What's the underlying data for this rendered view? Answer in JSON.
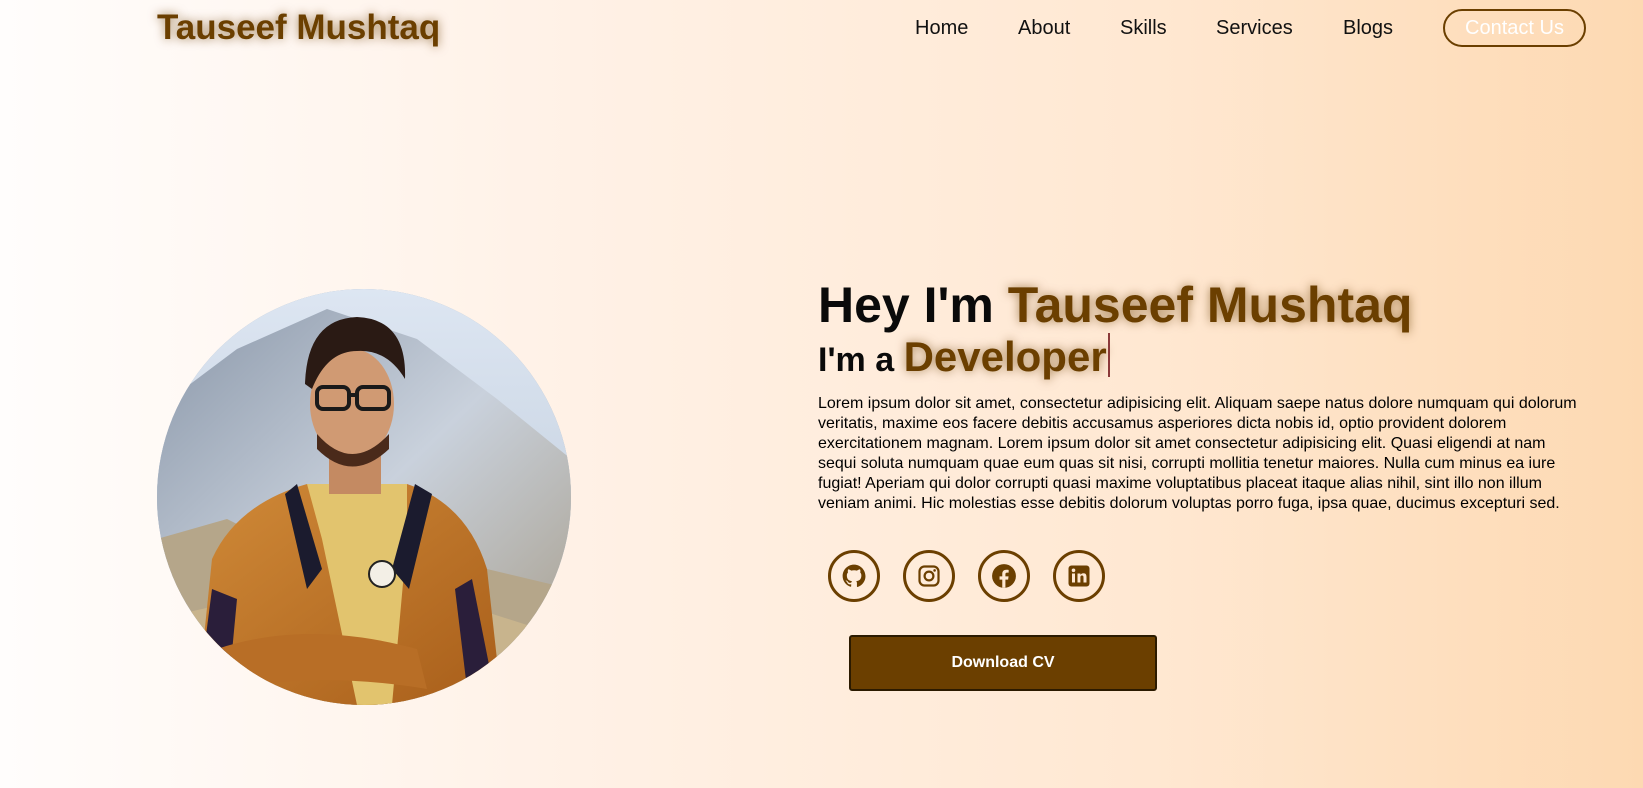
{
  "header": {
    "logo": "Tauseef Mushtaq",
    "nav": [
      {
        "label": "Home"
      },
      {
        "label": "About"
      },
      {
        "label": "Skills"
      },
      {
        "label": "Services"
      },
      {
        "label": "Blogs"
      }
    ],
    "contact_label": "Contact Us"
  },
  "hero": {
    "greeting": "Hey I'm ",
    "name": "Tauseef Mushtaq",
    "role_prefix": "I'm a ",
    "role": "Developer",
    "bio": "Lorem ipsum dolor sit amet, consectetur adipisicing elit. Aliquam saepe natus dolore numquam qui dolorum veritatis, maxime eos facere debitis accusamus asperiores dicta nobis id, optio provident dolorem exercitationem magnam. Lorem ipsum dolor sit amet consectetur adipisicing elit. Quasi eligendi at nam sequi soluta numquam quae eum quas sit nisi, corrupti mollitia tenetur maiores. Nulla cum minus ea iure fugiat! Aperiam qui dolor corrupti quasi maxime voluptatibus placeat itaque alias nihil, sint illo non illum veniam animi. Hic molestias esse debitis dolorum voluptas porro fuga, ipsa quae, ducimus excepturi sed.",
    "socials": [
      {
        "icon": "github-icon"
      },
      {
        "icon": "instagram-icon"
      },
      {
        "icon": "facebook-icon"
      },
      {
        "icon": "linkedin-icon"
      }
    ],
    "cv_label": "Download CV"
  },
  "colors": {
    "accent": "#6b3f00",
    "background_start": "#fffdfc",
    "background_end": "#fdd9b2"
  }
}
